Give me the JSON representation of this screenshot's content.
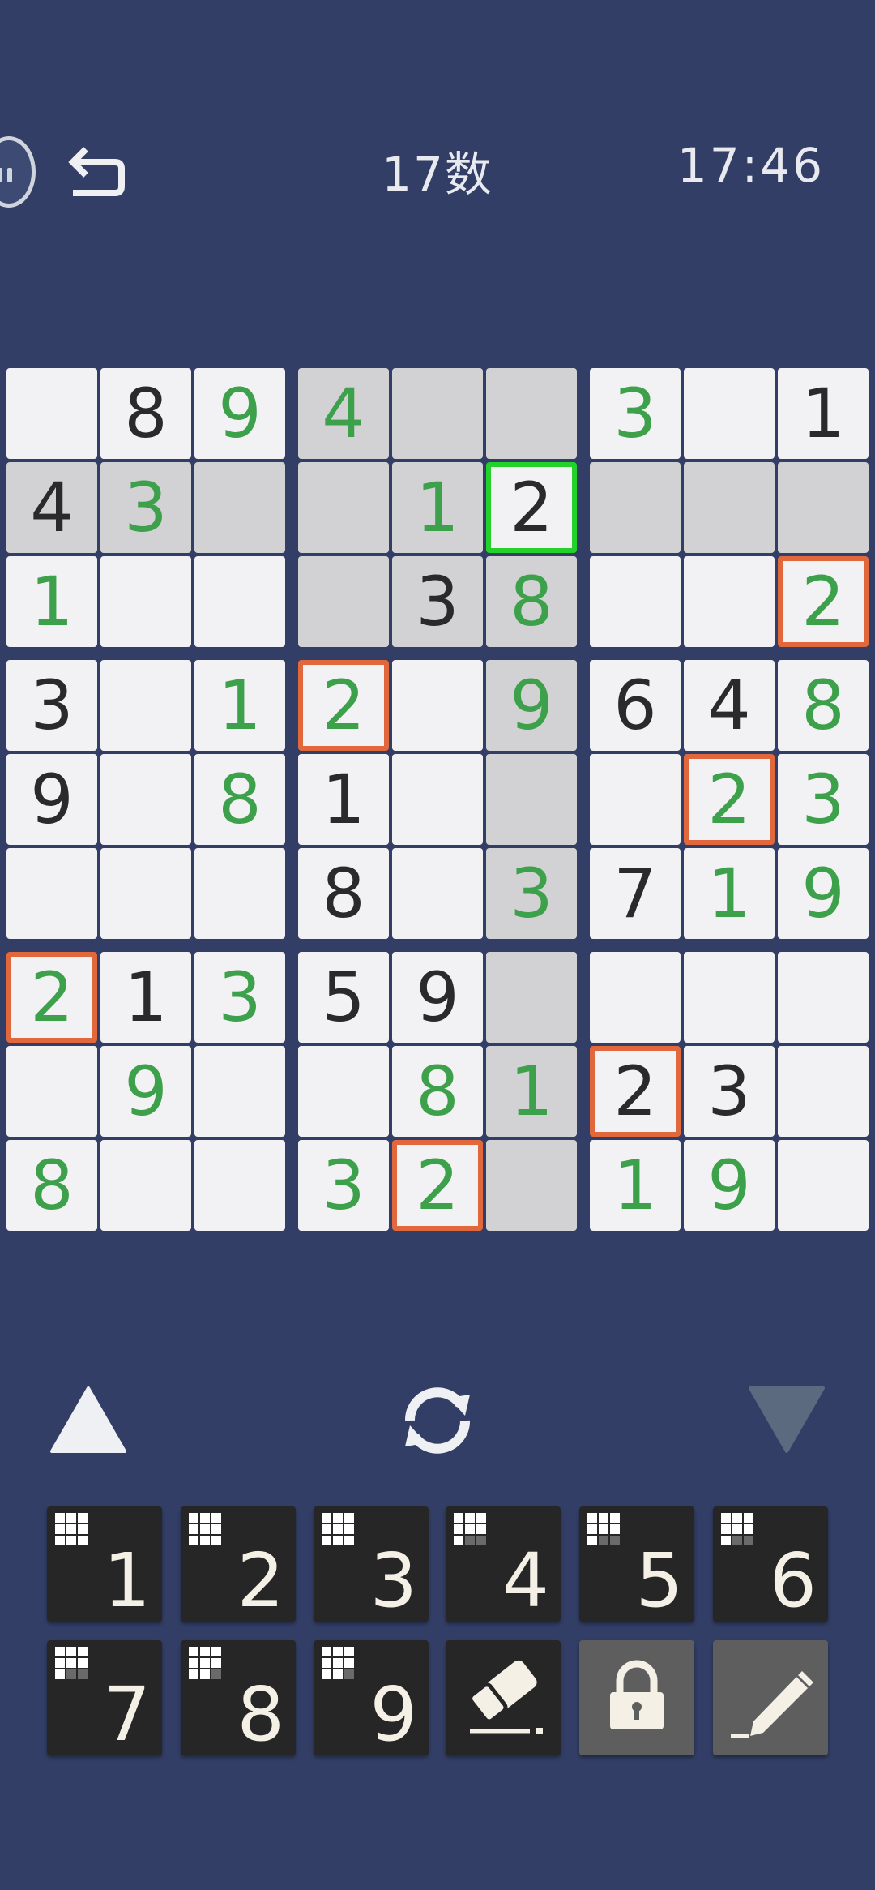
{
  "header": {
    "title": "17数",
    "timer": "17:46",
    "undo_icon": "undo-icon",
    "avatar_icon": "avatar-icon"
  },
  "board": {
    "rows": [
      [
        "",
        "8",
        "9",
        "4",
        "",
        "",
        "3",
        "",
        "1"
      ],
      [
        "4",
        "3",
        "",
        "",
        "1",
        "2",
        "",
        "",
        ""
      ],
      [
        "1",
        "",
        "",
        "",
        "3",
        "8",
        "",
        "",
        "2"
      ],
      [
        "3",
        "",
        "1",
        "2",
        "",
        "9",
        "6",
        "4",
        "8"
      ],
      [
        "9",
        "",
        "8",
        "1",
        "",
        "",
        "",
        "2",
        "3"
      ],
      [
        "",
        "",
        "",
        "8",
        "",
        "3",
        "7",
        "1",
        "9"
      ],
      [
        "2",
        "1",
        "3",
        "5",
        "9",
        "",
        "",
        "",
        ""
      ],
      [
        "",
        "9",
        "",
        "",
        "8",
        "1",
        "2",
        "3",
        ""
      ],
      [
        "8",
        "",
        "",
        "3",
        "2",
        "",
        "1",
        "9",
        ""
      ]
    ],
    "types": [
      [
        "e",
        "g",
        "u",
        "u",
        "e",
        "e",
        "u",
        "e",
        "g"
      ],
      [
        "g",
        "u",
        "e",
        "e",
        "u",
        "g",
        "e",
        "e",
        "e"
      ],
      [
        "u",
        "e",
        "e",
        "e",
        "g",
        "u",
        "e",
        "e",
        "u"
      ],
      [
        "g",
        "e",
        "u",
        "u",
        "e",
        "u",
        "g",
        "g",
        "u"
      ],
      [
        "g",
        "e",
        "u",
        "g",
        "e",
        "e",
        "e",
        "u",
        "u"
      ],
      [
        "e",
        "e",
        "e",
        "g",
        "e",
        "u",
        "g",
        "u",
        "u"
      ],
      [
        "u",
        "g",
        "u",
        "g",
        "g",
        "e",
        "e",
        "e",
        "e"
      ],
      [
        "e",
        "u",
        "e",
        "e",
        "u",
        "u",
        "g",
        "g",
        "e"
      ],
      [
        "u",
        "e",
        "e",
        "u",
        "u",
        "e",
        "u",
        "u",
        "e"
      ]
    ],
    "highlighted": [
      [
        0,
        3
      ],
      [
        0,
        4
      ],
      [
        0,
        5
      ],
      [
        1,
        0
      ],
      [
        1,
        1
      ],
      [
        1,
        2
      ],
      [
        1,
        3
      ],
      [
        1,
        4
      ],
      [
        1,
        6
      ],
      [
        1,
        7
      ],
      [
        1,
        8
      ],
      [
        2,
        3
      ],
      [
        2,
        4
      ],
      [
        2,
        5
      ],
      [
        3,
        5
      ],
      [
        4,
        5
      ],
      [
        5,
        5
      ],
      [
        6,
        5
      ],
      [
        7,
        5
      ],
      [
        8,
        5
      ]
    ],
    "selected": [
      1,
      5
    ],
    "conflicts": [
      [
        2,
        8
      ],
      [
        3,
        3
      ],
      [
        4,
        7
      ],
      [
        6,
        0
      ],
      [
        7,
        6
      ],
      [
        8,
        4
      ]
    ],
    "colors": {
      "given": "#2a2a2a",
      "user": "#3da04a",
      "selected_border": "#23d12a",
      "conflict_border": "#e0683c",
      "highlight": "#d2d2d4",
      "background": "#323e65"
    }
  },
  "controls": {
    "up_icon": "triangle-up-icon",
    "cycle_icon": "cycle-icon",
    "down_icon": "triangle-down-icon"
  },
  "keypad": {
    "numbers": [
      {
        "label": "1",
        "remaining": 9
      },
      {
        "label": "2",
        "remaining": 9
      },
      {
        "label": "3",
        "remaining": 9
      },
      {
        "label": "4",
        "remaining": 7
      },
      {
        "label": "5",
        "remaining": 7
      },
      {
        "label": "6",
        "remaining": 7
      },
      {
        "label": "7",
        "remaining": 7
      },
      {
        "label": "8",
        "remaining": 8
      },
      {
        "label": "9",
        "remaining": 8
      }
    ],
    "eraser_icon": "eraser-icon",
    "lock_icon": "lock-icon",
    "pencil_icon": "pencil-icon"
  }
}
